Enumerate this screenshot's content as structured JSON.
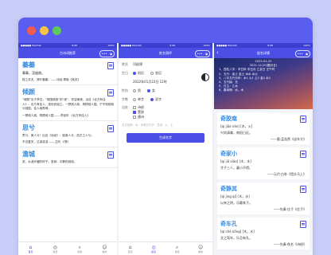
{
  "window": {
    "controls": [
      "close",
      "minimize",
      "maximize"
    ]
  },
  "status_bar": {
    "carrier": "●●●●● WeChat",
    "time": "8:08",
    "battery": "100%"
  },
  "panel1": {
    "nav_title": "古诗词推荐",
    "capsule": {
      "more": "•••",
      "close": "◉"
    },
    "cards": [
      {
        "title": "蓁蓁",
        "subtitle": "蓁蓁，茂盛貌。",
        "text": "桃之夭夭，其叶蓁蓁。——诗经·周南《桃夭》",
        "source": "桃之夭夭  ——诗经·周南  《国风·桃夭》"
      },
      {
        "title": "倾颜",
        "subtitle": "",
        "text": "“倾颜”出于李白，“倾国倾城”的“倾”，形容美貌，出自《北方有佳人》：北方有佳人，绝世而独立。一顾倾人城，再顾倾人国。宁不知倾城与倾国，佳人难再得。",
        "source": "一顾倾人城，再顾倾人国  ——李延年  《北方有佳人》"
      },
      {
        "title": "思兮",
        "subtitle": "",
        "text": "思兮，美人兮！出自《诗经》：彼美人兮，西方之人兮。",
        "source": "不见复关，泣涕涟涟  ——卫风  《氓》"
      },
      {
        "title": "澹城",
        "subtitle": "",
        "text": "澹，水波纡缓的样子。澹城：平静的城池。",
        "source": ""
      }
    ],
    "tabs": [
      {
        "label": "首页",
        "icon": "home-icon",
        "active": true
      },
      {
        "label": "发现",
        "icon": "compass-icon",
        "active": false
      },
      {
        "label": "搜索",
        "icon": "search-icon",
        "active": false
      },
      {
        "label": "我的",
        "icon": "user-icon",
        "active": false
      }
    ]
  },
  "panel2": {
    "nav_title": "姓名测评",
    "capsule": {
      "more": "•••",
      "close": "◉"
    },
    "form": {
      "surname_label": "姓氏",
      "surname_value": "司徒锦",
      "birth_label": "生日",
      "calendar_options": [
        {
          "label": "阳历",
          "checked": true
        },
        {
          "label": "农历",
          "checked": false
        }
      ],
      "birth_value": "2022年01月22日 12时",
      "gender_label": "性别",
      "gender_options": [
        {
          "label": "男",
          "checked": false
        },
        {
          "label": "女",
          "checked": true
        }
      ],
      "style_label": "字数",
      "style_options": [
        {
          "label": "单字",
          "checked": false
        },
        {
          "label": "双字",
          "checked": true
        }
      ],
      "extra_label": "出处",
      "extra_options": [
        {
          "label": "诗经",
          "checked": false
        },
        {
          "label": "楚辞",
          "checked": true
        },
        {
          "label": "唐诗",
          "checked": false
        }
      ],
      "note": "名字宜用：木、水等五行字，忌用：火、土",
      "submit": "生成名字"
    },
    "tabs": [
      {
        "label": "首页",
        "icon": "home-icon",
        "active": false
      },
      {
        "label": "起名",
        "icon": "compass-icon",
        "active": true
      },
      {
        "label": "搜索",
        "icon": "search-icon",
        "active": false
      },
      {
        "label": "我的",
        "icon": "user-icon",
        "active": false
      }
    ]
  },
  "panel3": {
    "nav_title": "起名详情",
    "capsule": {
      "more": "•••",
      "close": "◉"
    },
    "hero": {
      "date": "2022-01-22",
      "lunar": "2021-12-20(腊月廿)",
      "lines": [
        "1、四柱八字：辛丑年 辛丑月 乙亥日 壬午时",
        "2、五行：金土 金土 木水 水火",
        "3、八字五行分布：木1 火1 土2 金2 水2",
        "4、五行缺：无",
        "5、日主：乙木",
        "6、喜用神：水、木"
      ]
    },
    "cards": [
      {
        "title": "奇胶南",
        "pinyin": "[qí jiāo nán]  [木，火]",
        "meaning": "兴尚清尊，南阳日近。",
        "source": "——唐·孟浩然《送辛大》"
      },
      {
        "title": "奇家小",
        "pinyin": "[qí jiā xiǎo]  [木，木]",
        "meaning": "才子三人，妻小不得。",
        "source": "——元代·白朴《墙头马上》"
      },
      {
        "title": "奇静其",
        "pinyin": "[qí jìng qí]  [木，水]",
        "meaning": "以亲之明，乐静其子。",
        "source": "——先秦·庄子《庄子》"
      },
      {
        "title": "奇车孔",
        "pinyin": "[qí chē kǒng]  [木，水]",
        "meaning": "文之驾车，乐且有孔。",
        "source": "——先秦·佚名《诗经》"
      }
    ]
  }
}
